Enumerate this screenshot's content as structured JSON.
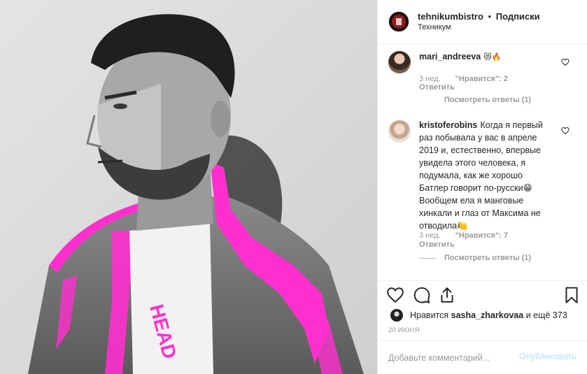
{
  "post": {
    "username": "tehnikumbistro",
    "separator": "•",
    "follow_label": "Подписки",
    "location": "Техникум"
  },
  "comments": [
    {
      "username": "mari_andreeva",
      "text": "😻🔥",
      "time": "3 нед.",
      "likes": "\"Нравится\": 2",
      "reply_label": "Ответить",
      "view_replies": "Посмотреть ответы (1)"
    },
    {
      "username": "kristoferobins",
      "text": "Когда я первый раз побывала у вас в апреле 2019 и, естественно, впервые увидела этого человека, я подумала, как же хорошо Батлер говорит по-русски😁 Вообщем ела я манговые хинкали и глаз от Максима не отводила🍋",
      "time": "3 нед.",
      "likes": "\"Нравится\": 7",
      "reply_label": "Ответить",
      "view_replies": "Посмотреть ответы (1)"
    }
  ],
  "likes_summary": {
    "prefix": "Нравится",
    "user": "sasha_zharkovaa",
    "suffix": "и ещё 373"
  },
  "date": "20 ИЮНЯ",
  "comment_input": {
    "placeholder": "Добавьте комментарий...",
    "publish_label": "Опубликовать"
  },
  "colors": {
    "accent_pink": "#ff2fcf",
    "publish_disabled": "#b2dffc",
    "muted_text": "#999999"
  },
  "icons": {
    "like": "heart-icon",
    "comment": "comment-bubble-icon",
    "share": "share-icon",
    "save": "bookmark-icon",
    "comment_like": "small-heart-icon"
  }
}
